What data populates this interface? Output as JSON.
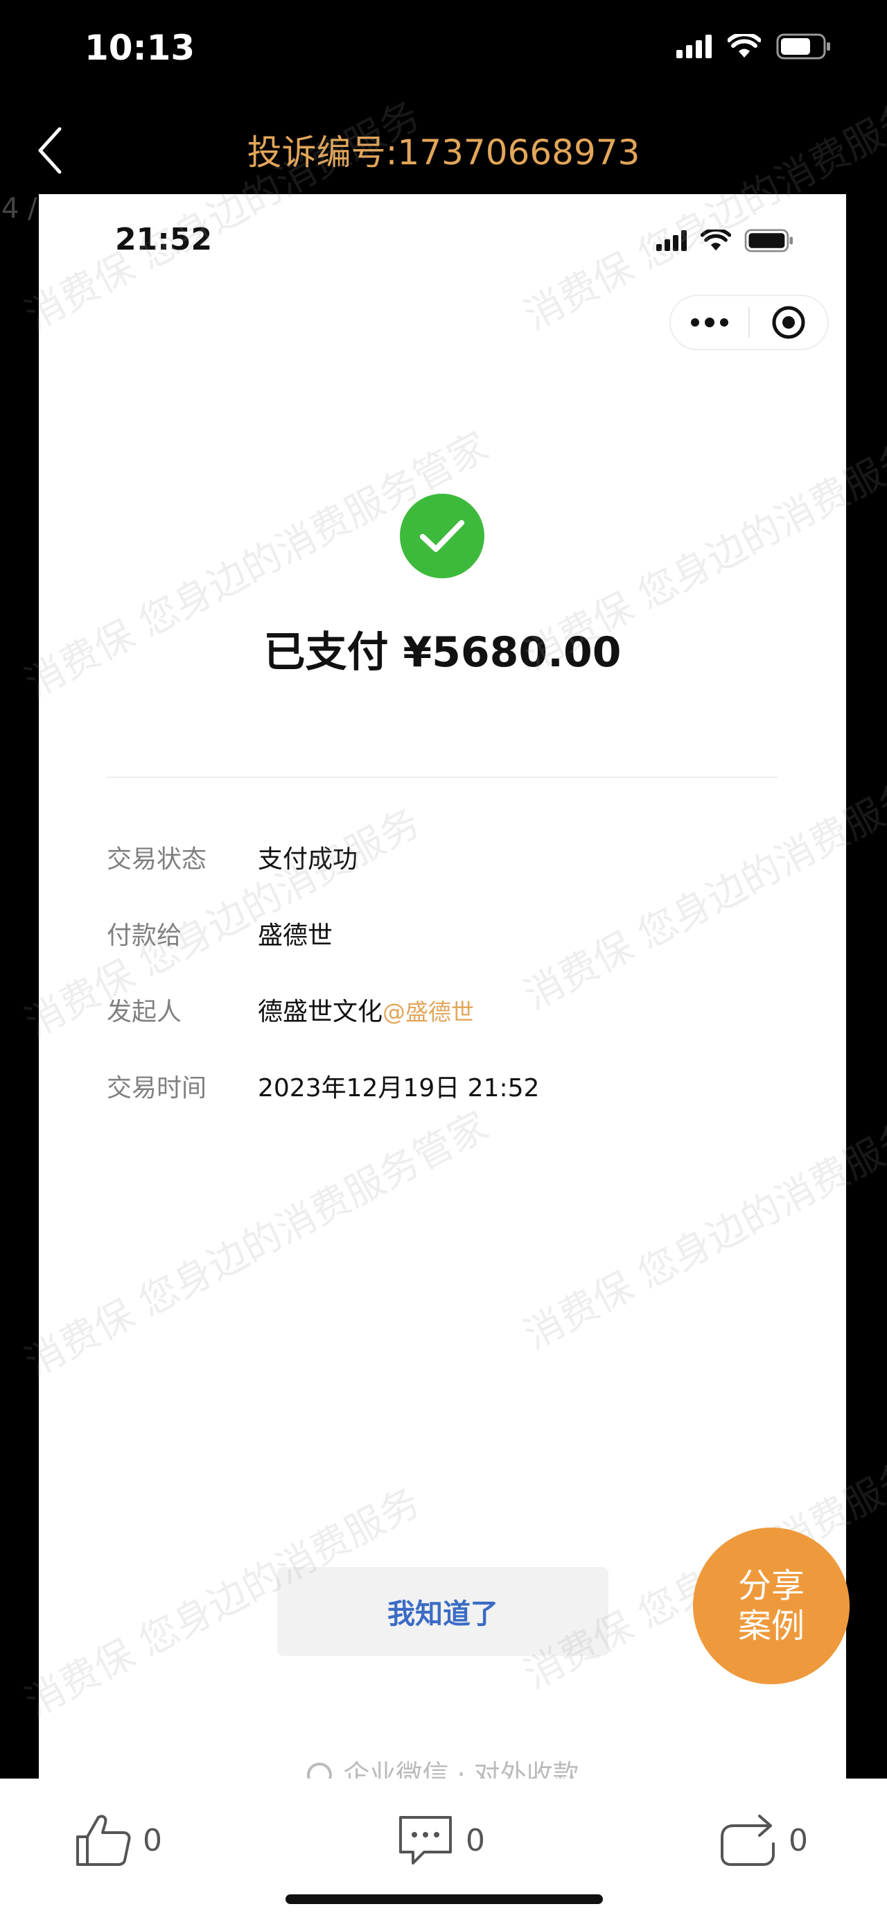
{
  "status_bar": {
    "time": "10:13"
  },
  "nav": {
    "title": "投诉编号:17370668973",
    "page_indicator": "4 /"
  },
  "screenshot": {
    "status_bar": {
      "time": "21:52"
    },
    "payment": {
      "title": "已支付 ¥5680.00",
      "rows": [
        {
          "label": "交易状态",
          "value": "支付成功"
        },
        {
          "label": "付款给",
          "value": "盛德世"
        },
        {
          "label": "发起人",
          "value": "德盛世文化",
          "handle": "@盛德世"
        },
        {
          "label": "交易时间",
          "value": "2023年12月19日 21:52"
        }
      ],
      "ok_button": "我知道了",
      "footer": "企业微信 · 对外收款"
    }
  },
  "share_button": {
    "line1": "分享",
    "line2": "案例"
  },
  "actions": {
    "like_count": "0",
    "comment_count": "0",
    "share_count": "0"
  },
  "watermark": {
    "text_a": "消费保 您身边的消费服务管家",
    "text_b": "消费保 您身边的消费服务"
  },
  "colors": {
    "accent": "#e2a65a",
    "success": "#3dba3c",
    "share": "#ee9a3c",
    "link": "#3b6cc4"
  }
}
